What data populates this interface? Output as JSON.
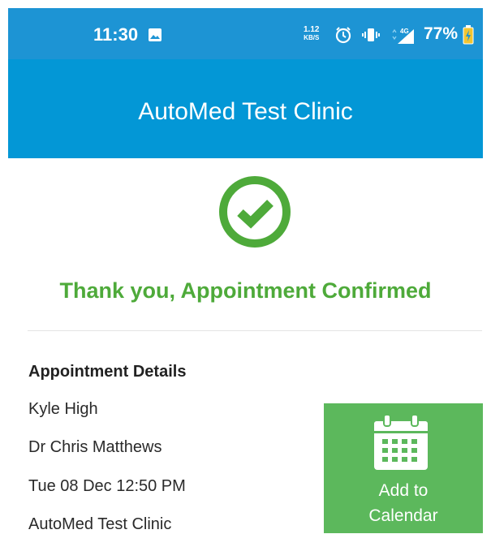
{
  "status_bar": {
    "time": "11:30",
    "net_speed_value": "1.12",
    "net_speed_unit": "KB/S",
    "network": "4G",
    "battery": "77%",
    "icons": [
      "image-icon",
      "alarm-icon",
      "vibrate-icon",
      "signal-4g-icon",
      "battery-icon"
    ]
  },
  "app_bar": {
    "title": "AutoMed Test Clinic"
  },
  "confirmation": {
    "icon": "check-circle-icon",
    "message": "Thank you, Appointment Confirmed",
    "color": "#4eaa3a"
  },
  "details": {
    "heading": "Appointment Details",
    "patient": "Kyle High",
    "doctor": "Dr Chris Matthews",
    "datetime": "Tue 08 Dec 12:50 PM",
    "clinic": "AutoMed Test Clinic"
  },
  "calendar_button": {
    "line1": "Add to",
    "line2": "Calendar",
    "icon": "calendar-icon",
    "color": "#5cb85c"
  },
  "colors": {
    "primary": "#0397d6",
    "status_bar": "#1d94d4"
  }
}
